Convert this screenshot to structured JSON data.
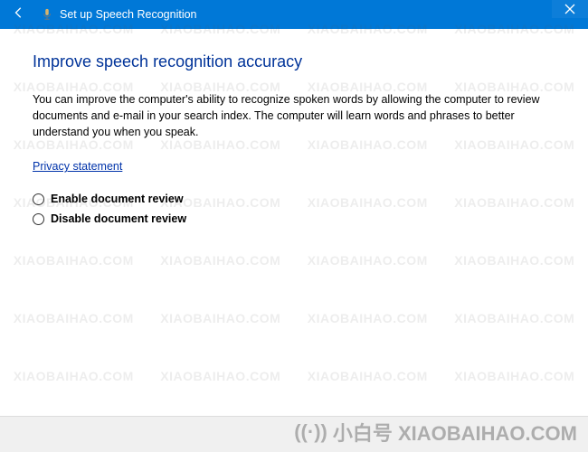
{
  "titlebar": {
    "title": "Set up Speech Recognition"
  },
  "main": {
    "heading": "Improve speech recognition accuracy",
    "description": "You can improve the computer's ability to recognize spoken words by allowing the computer to review documents and e-mail in your search index. The computer will learn words and phrases to better understand you when you speak.",
    "privacy_link": "Privacy statement",
    "options": {
      "enable": "Enable document review",
      "disable": "Disable document review"
    }
  },
  "watermark": {
    "text": "XIAOBAIHAO.COM",
    "brand": "小白号 XIAOBAIHAO.COM"
  }
}
